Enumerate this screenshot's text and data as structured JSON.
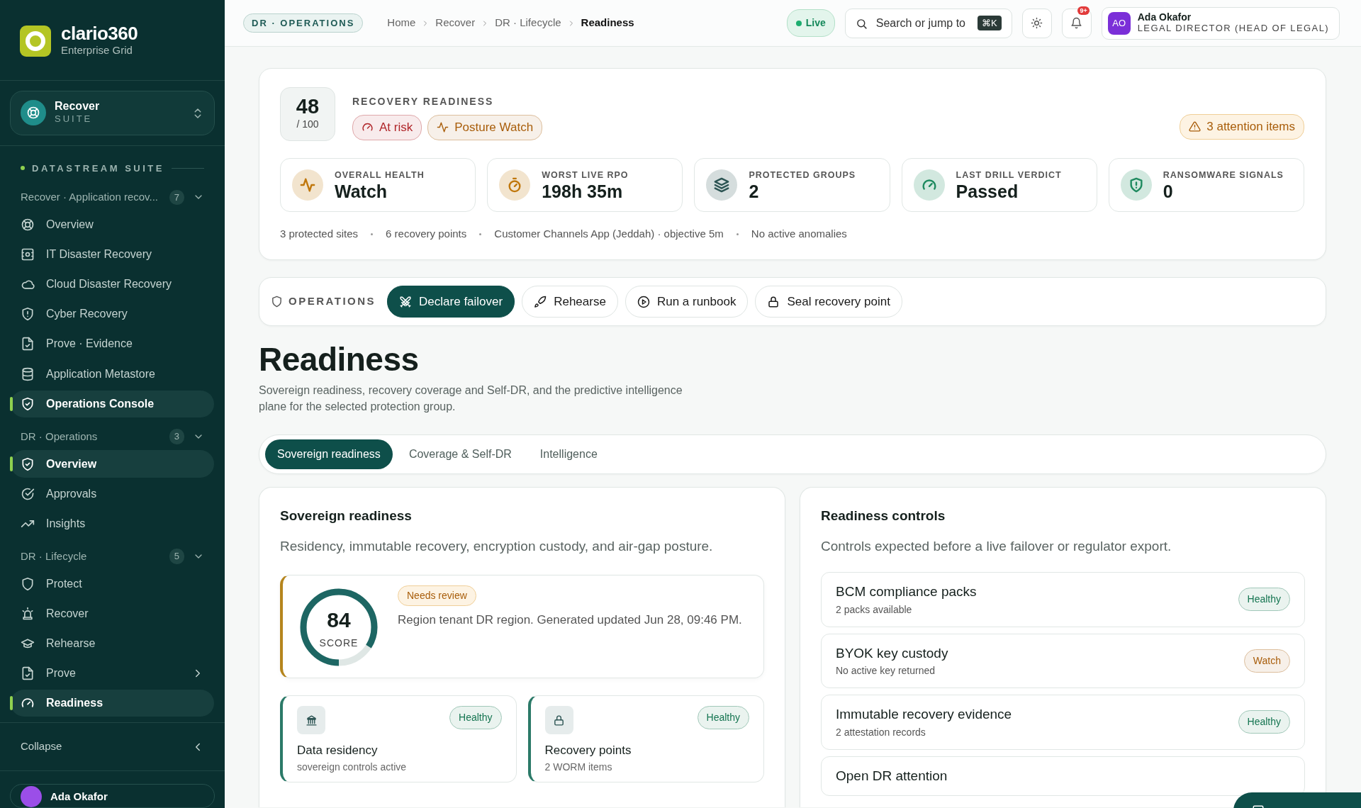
{
  "sidebar": {
    "brand": {
      "name": "clario360",
      "subtitle": "Enterprise Grid"
    },
    "suite": {
      "name": "Recover",
      "label": "SUITE"
    },
    "section_label": "DATASTREAM SUITE",
    "groups": [
      {
        "label": "Recover · Application recov...",
        "count": "7",
        "expanded": true,
        "items": [
          {
            "label": "Overview",
            "selected": false
          },
          {
            "label": "IT Disaster Recovery",
            "selected": false
          },
          {
            "label": "Cloud Disaster Recovery",
            "selected": false
          },
          {
            "label": "Cyber Recovery",
            "selected": false
          },
          {
            "label": "Prove · Evidence",
            "selected": false
          },
          {
            "label": "Application Metastore",
            "selected": false
          },
          {
            "label": "Operations Console",
            "selected": true
          }
        ]
      },
      {
        "label": "DR · Operations",
        "count": "3",
        "expanded": true,
        "items": [
          {
            "label": "Overview",
            "selected": true
          },
          {
            "label": "Approvals",
            "selected": false
          },
          {
            "label": "Insights",
            "selected": false
          }
        ]
      },
      {
        "label": "DR · Lifecycle",
        "count": "5",
        "expanded": true,
        "items": [
          {
            "label": "Protect",
            "selected": false
          },
          {
            "label": "Recover",
            "selected": false
          },
          {
            "label": "Rehearse",
            "selected": false
          },
          {
            "label": "Prove",
            "selected": false,
            "has_children": true
          },
          {
            "label": "Readiness",
            "selected": true
          }
        ]
      }
    ],
    "collapse": "Collapse",
    "user": {
      "name": "Ada Okafor"
    }
  },
  "header": {
    "context": "DR · OPERATIONS",
    "breadcrumbs": [
      "Home",
      "Recover",
      "DR · Lifecycle",
      "Readiness"
    ],
    "live": "Live",
    "search": {
      "placeholder": "Search or jump to",
      "shortcut": "⌘K"
    },
    "notifications": "9+",
    "user": {
      "initials": "AO",
      "name": "Ada Okafor",
      "role": "LEGAL DIRECTOR (HEAD OF LEGAL)"
    }
  },
  "summary": {
    "score": "48",
    "score_max": "/ 100",
    "label": "RECOVERY READINESS",
    "badges": [
      {
        "text": "At risk",
        "color": "#b0262a"
      },
      {
        "text": "Posture Watch",
        "color": "#a85d0a"
      }
    ],
    "attention": "3 attention items",
    "kpis": [
      {
        "label": "OVERALL HEALTH",
        "value": "Watch",
        "color": "#c0770c"
      },
      {
        "label": "WORST LIVE RPO",
        "value": "198h 35m",
        "color": "#c0770c"
      },
      {
        "label": "PROTECTED GROUPS",
        "value": "2",
        "color": "#2c5453"
      },
      {
        "label": "LAST DRILL VERDICT",
        "value": "Passed",
        "color": "#1e8a5f"
      },
      {
        "label": "RANSOMWARE SIGNALS",
        "value": "0",
        "color": "#1e8a5f"
      }
    ],
    "facts": [
      "3 protected sites",
      "6 recovery points",
      "Customer Channels App (Jeddah) · objective 5m",
      "No active anomalies"
    ]
  },
  "operations": {
    "label": "OPERATIONS",
    "actions": [
      {
        "label": "Declare failover",
        "primary": true
      },
      {
        "label": "Rehearse",
        "primary": false
      },
      {
        "label": "Run a runbook",
        "primary": false
      },
      {
        "label": "Seal recovery point",
        "primary": false
      }
    ]
  },
  "page": {
    "title": "Readiness",
    "description": "Sovereign readiness, recovery coverage and Self-DR, and the predictive intelligence plane for the selected protection group."
  },
  "tabs": [
    {
      "label": "Sovereign readiness",
      "selected": true
    },
    {
      "label": "Coverage & Self-DR",
      "selected": false
    },
    {
      "label": "Intelligence",
      "selected": false
    }
  ],
  "sovereign": {
    "title": "Sovereign readiness",
    "subtitle": "Residency, immutable recovery, encryption custody, and air-gap posture.",
    "score": {
      "value": "84",
      "label": "SCORE",
      "level": 0.84,
      "badge": "Needs review",
      "text": "Region tenant DR region. Generated updated Jun 28, 09:46 PM."
    },
    "controls": [
      {
        "title": "Data residency",
        "detail": "sovereign controls active",
        "status": "Healthy",
        "color": "#157551"
      },
      {
        "title": "Recovery points",
        "detail": "2 WORM items",
        "status": "Healthy",
        "color": "#157551"
      }
    ]
  },
  "readiness_controls": {
    "title": "Readiness controls",
    "subtitle": "Controls expected before a live failover or regulator export.",
    "items": [
      {
        "title": "BCM compliance packs",
        "detail": "2 packs available",
        "status": "Healthy",
        "color": "#157551"
      },
      {
        "title": "BYOK key custody",
        "detail": "No active key returned",
        "status": "Watch",
        "color": "#a85d0a"
      },
      {
        "title": "Immutable recovery evidence",
        "detail": "2 attestation records",
        "status": "Healthy",
        "color": "#157551"
      },
      {
        "title": "Open DR attention"
      }
    ]
  }
}
